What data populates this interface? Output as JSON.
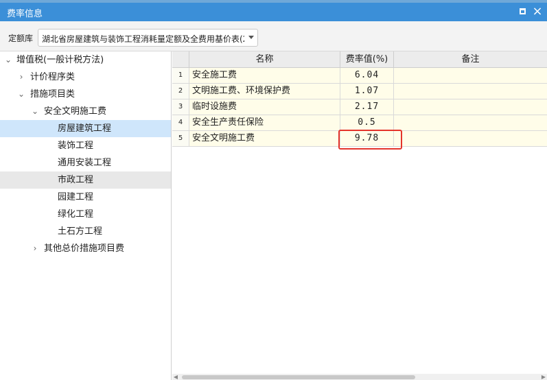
{
  "window": {
    "title": "费率信息",
    "max_icon": "maximize-icon",
    "close_icon": "close-icon",
    "close_glyph": "×"
  },
  "toolbar": {
    "library_label": "定额库",
    "library_value": "湖北省房屋建筑与装饰工程消耗量定额及全费用基价表(2"
  },
  "tree": {
    "items": [
      {
        "label": "增值税(一般计税方法)",
        "expanded": true
      },
      {
        "label": "计价程序类",
        "expanded": false
      },
      {
        "label": "措施项目类",
        "expanded": true
      },
      {
        "label": "安全文明施工费",
        "expanded": true
      },
      {
        "label": "房屋建筑工程",
        "state": "selected"
      },
      {
        "label": "装饰工程"
      },
      {
        "label": "通用安装工程"
      },
      {
        "label": "市政工程",
        "state": "hover"
      },
      {
        "label": "园建工程"
      },
      {
        "label": "绿化工程"
      },
      {
        "label": "土石方工程"
      },
      {
        "label": "其他总价措施项目费",
        "expanded": false
      }
    ]
  },
  "grid": {
    "columns": [
      "",
      "名称",
      "费率值(%)",
      "备注"
    ],
    "rows": [
      {
        "no": "1",
        "name": "安全施工费",
        "rate": "6.04",
        "note": ""
      },
      {
        "no": "2",
        "name": "文明施工费、环境保护费",
        "rate": "1.07",
        "note": ""
      },
      {
        "no": "3",
        "name": "临时设施费",
        "rate": "2.17",
        "note": ""
      },
      {
        "no": "4",
        "name": "安全生产责任保险",
        "rate": "0.5",
        "note": ""
      },
      {
        "no": "5",
        "name": "安全文明施工费",
        "rate": "9.78",
        "note": ""
      }
    ]
  },
  "colors": {
    "titlebar": "#3b8fd8",
    "row_bg": "#fffde9",
    "selected": "#cfe6fb",
    "highlight": "#e4332b"
  }
}
